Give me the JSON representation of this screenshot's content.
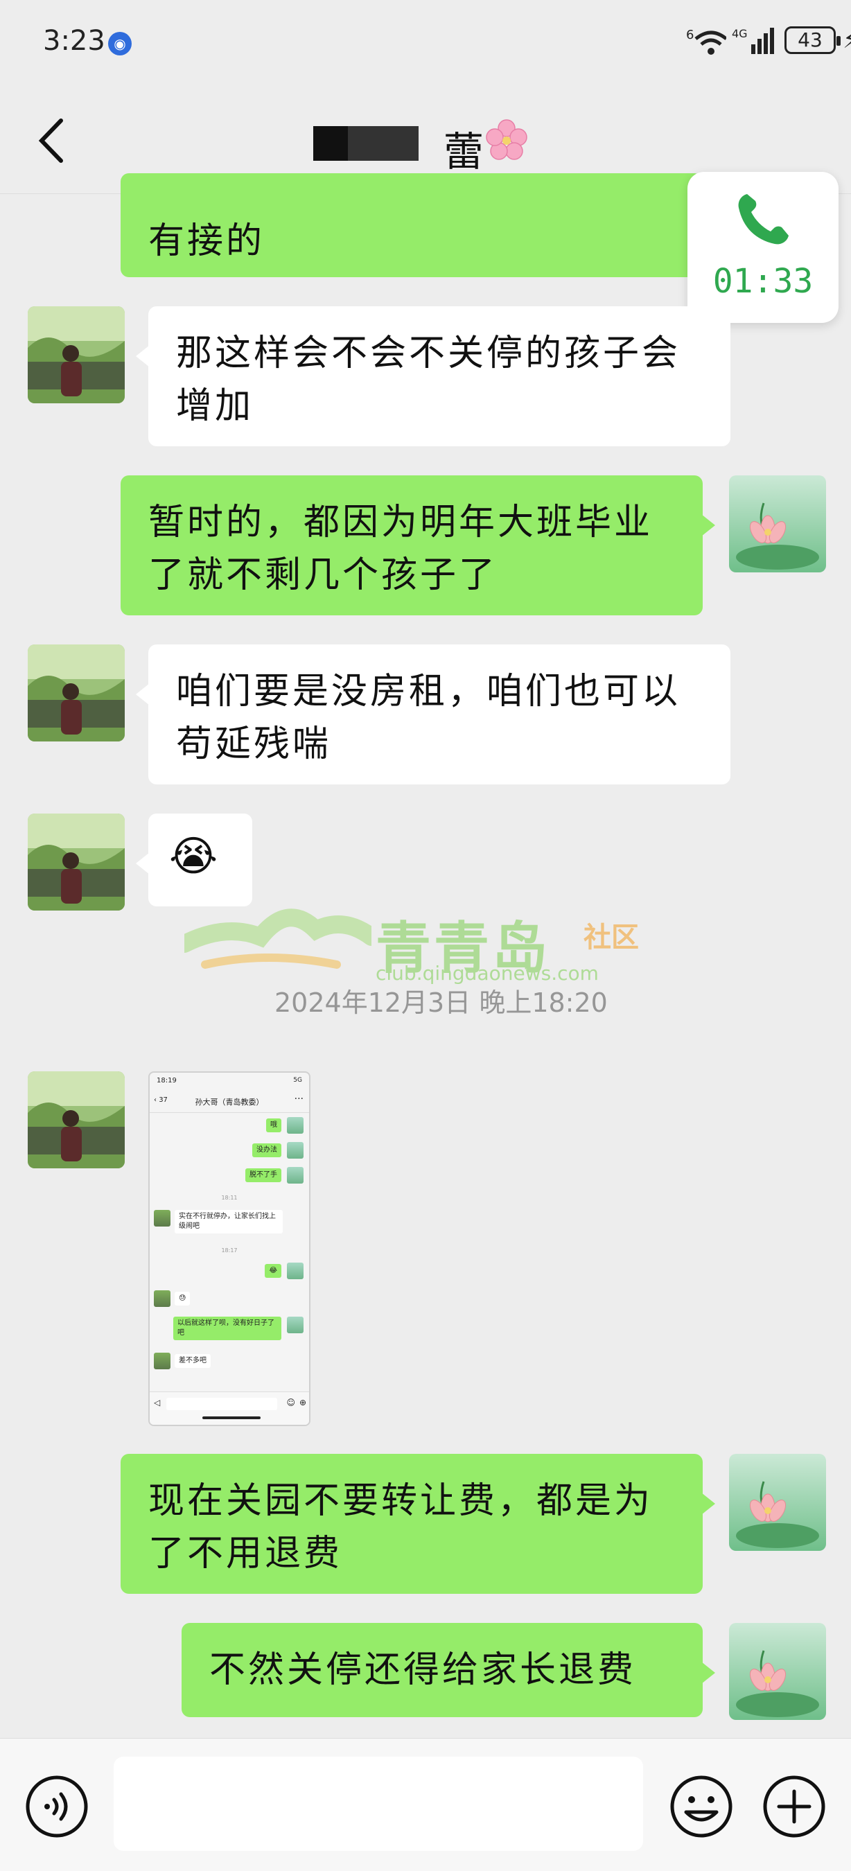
{
  "status_bar": {
    "time": "3:23",
    "notification_icon": "blue-circle-icon",
    "signal_label": "6",
    "network_label": "4G",
    "battery_level": "43"
  },
  "header": {
    "title_visible": "蕾",
    "title_icon": "cherry-blossom-emoji"
  },
  "call_card": {
    "icon": "phone-icon",
    "duration": "01:33"
  },
  "messages": [
    {
      "from": "me",
      "text": "有接的"
    },
    {
      "from": "other",
      "text": "那这样会不会不关停的孩子会增加"
    },
    {
      "from": "me",
      "text": "暂时的，都因为明年大班毕业了就不剩几个孩子了"
    },
    {
      "from": "other",
      "text": "咱们要是没房租，咱们也可以苟延残喘"
    },
    {
      "from": "other",
      "text": "😭",
      "type": "emoji"
    },
    {
      "from": "other",
      "type": "image",
      "image": {
        "status_time": "18:19",
        "status_right": "5G",
        "back_count": "37",
        "chat_title": "孙大哥（青岛教委）",
        "messages": [
          {
            "from": "me",
            "text": "哦"
          },
          {
            "from": "me",
            "text": "没办法"
          },
          {
            "from": "me",
            "text": "脱不了手"
          },
          {
            "time": "18:11"
          },
          {
            "from": "other",
            "text": "实在不行就停办，让家长们找上级闹吧"
          },
          {
            "time": "18:17"
          },
          {
            "from": "me",
            "text": "😂"
          },
          {
            "from": "other",
            "text": "😓"
          },
          {
            "from": "me",
            "text": "以后就这样了呗，没有好日子了吧"
          },
          {
            "from": "other",
            "text": "差不多吧"
          }
        ]
      }
    },
    {
      "from": "me",
      "text": "现在关园不要转让费，都是为了不用退费"
    },
    {
      "from": "me",
      "text": "不然关停还得给家长退费"
    }
  ],
  "watermark": {
    "title": "青青岛",
    "subtitle": "社区",
    "url": "club.qingdaonews.com",
    "date_text": "2024年12月3日 晚上18:20"
  },
  "input_bar": {
    "voice_icon": "voice-icon",
    "emoji_icon": "emoji-icon",
    "plus_icon": "plus-icon",
    "input_value": ""
  },
  "colors": {
    "my_bubble": "#95ec69",
    "their_bubble": "#ffffff",
    "background": "#ededed",
    "call_green": "#2fa84f"
  }
}
